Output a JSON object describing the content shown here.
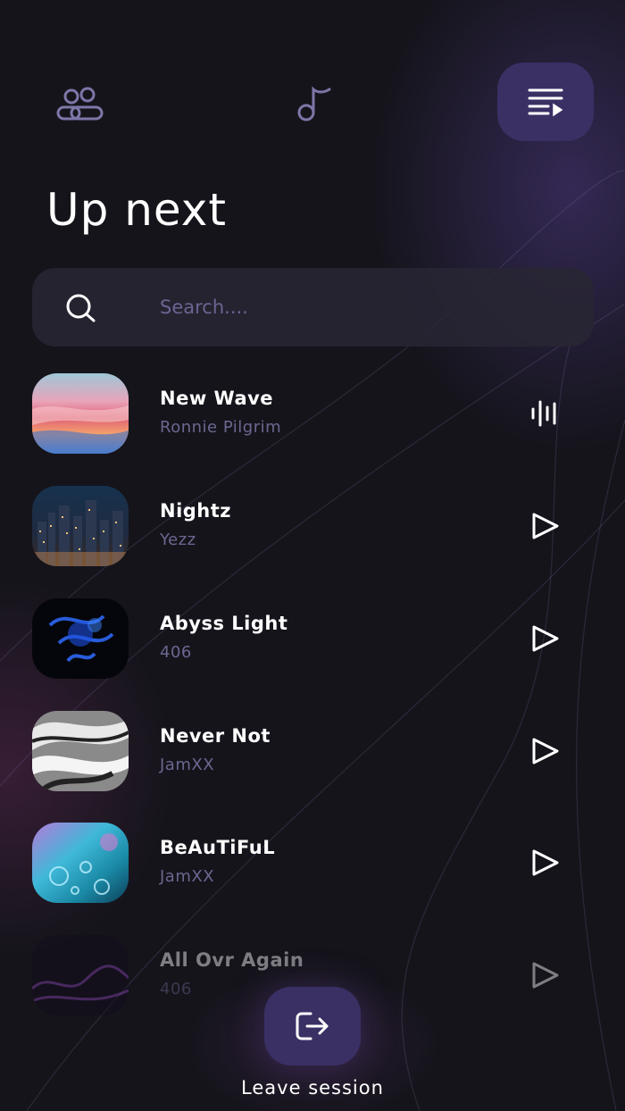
{
  "nav": {
    "items": [
      {
        "icon": "people-icon"
      },
      {
        "icon": "music-note-icon"
      },
      {
        "icon": "queue-icon",
        "active": true
      }
    ]
  },
  "page": {
    "title": "Up next"
  },
  "search": {
    "placeholder": "Search....",
    "value": ""
  },
  "tracks": [
    {
      "title": "New Wave",
      "artist": "Ronnie Pilgrim",
      "state": "playing",
      "action_icon": "equalizer-icon"
    },
    {
      "title": "Nightz",
      "artist": "Yezz",
      "state": "idle",
      "action_icon": "play-icon"
    },
    {
      "title": "Abyss Light",
      "artist": "406",
      "state": "idle",
      "action_icon": "play-icon"
    },
    {
      "title": "Never Not",
      "artist": "JamXX",
      "state": "idle",
      "action_icon": "play-icon"
    },
    {
      "title": "BeAuTiFuL",
      "artist": "JamXX",
      "state": "idle",
      "action_icon": "play-icon"
    },
    {
      "title": "All Ovr Again",
      "artist": "406",
      "state": "idle",
      "action_icon": "play-icon"
    }
  ],
  "footer": {
    "leave_label": "Leave session",
    "leave_icon": "exit-icon"
  },
  "colors": {
    "accent": "#3a3064",
    "background": "#15141b",
    "muted_text": "#6b6790"
  }
}
